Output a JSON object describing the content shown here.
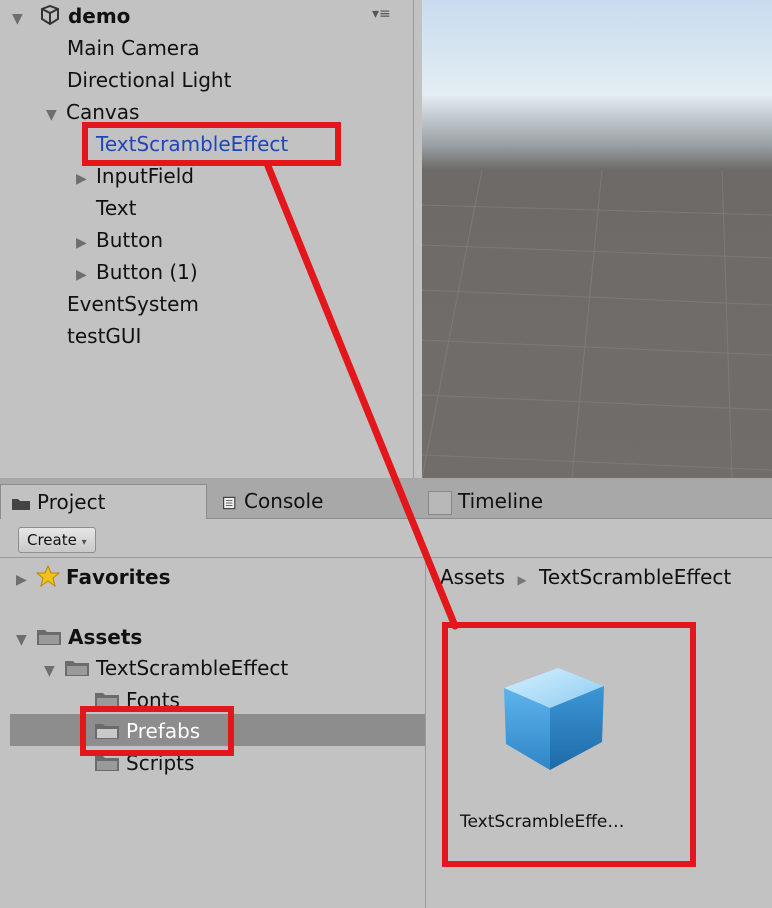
{
  "hierarchy": {
    "scene_name": "demo",
    "items": [
      {
        "label": "Main Camera"
      },
      {
        "label": "Directional Light"
      },
      {
        "label": "Canvas"
      },
      {
        "label": "TextScrambleEffect"
      },
      {
        "label": "InputField"
      },
      {
        "label": "Text"
      },
      {
        "label": "Button"
      },
      {
        "label": "Button (1)"
      },
      {
        "label": "EventSystem"
      },
      {
        "label": "testGUI"
      }
    ]
  },
  "tabs": [
    {
      "label": "Project"
    },
    {
      "label": "Console"
    },
    {
      "label": "Timeline"
    }
  ],
  "toolbar": {
    "create_label": "Create"
  },
  "project_tree": {
    "favorites": "Favorites",
    "assets": "Assets",
    "folders": [
      {
        "label": "TextScrambleEffect"
      },
      {
        "label": "Fonts"
      },
      {
        "label": "Prefabs"
      },
      {
        "label": "Scripts"
      }
    ]
  },
  "assets_pane": {
    "breadcrumb_root": "Assets",
    "breadcrumb_current": "TextScrambleEffect",
    "asset_label": "TextScrambleEffe…"
  },
  "colors": {
    "annotation_red": "#e3161c",
    "selection_text": "#1f46b8",
    "panel_bg": "#c2c2c2"
  }
}
